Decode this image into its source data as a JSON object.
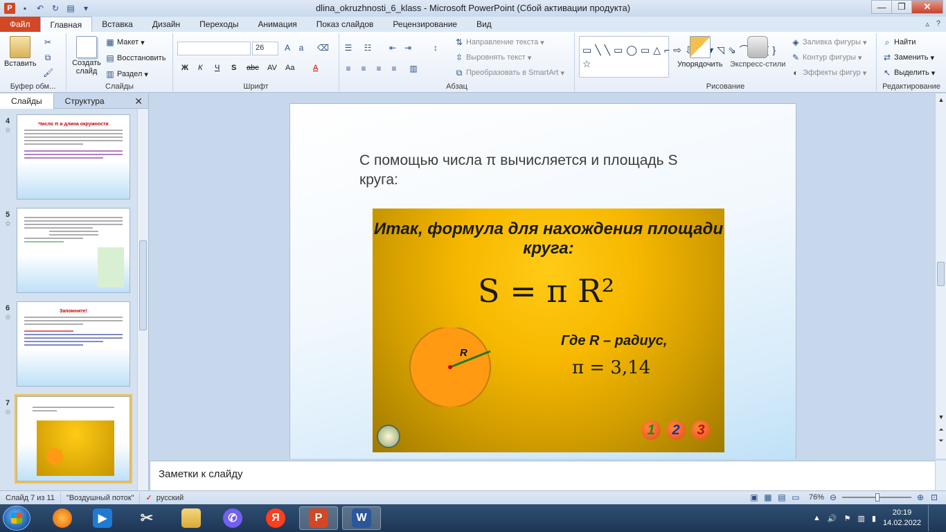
{
  "window": {
    "title": "dlina_okruzhnosti_6_klass  -  Microsoft PowerPoint (Сбой активации продукта)",
    "controls": [
      "—",
      "❐",
      "✕"
    ]
  },
  "ribbon_tabs": [
    "Файл",
    "Главная",
    "Вставка",
    "Дизайн",
    "Переходы",
    "Анимация",
    "Показ слайдов",
    "Рецензирование",
    "Вид"
  ],
  "ribbon": {
    "clipboard": {
      "label": "Буфер обм...",
      "paste": "Вставить"
    },
    "slides": {
      "label": "Слайды",
      "new_slide": "Создать слайд",
      "layout": "Макет",
      "reset": "Восстановить",
      "section": "Раздел"
    },
    "font": {
      "label": "Шрифт",
      "font_name": "",
      "font_size": "26",
      "bold": "Ж",
      "italic": "К",
      "underline": "Ч",
      "shadow": "S",
      "strike": "abc",
      "spacing": "AV",
      "case": "Aa",
      "color": "A"
    },
    "paragraph": {
      "label": "Абзац",
      "text_direction": "Направление текста",
      "align_text": "Выровнять текст",
      "smartart": "Преобразовать в SmartArt"
    },
    "drawing": {
      "label": "Рисование",
      "arrange": "Упорядочить",
      "quick_styles": "Экспресс-стили",
      "shape_fill": "Заливка фигуры",
      "shape_outline": "Контур фигуры",
      "shape_effects": "Эффекты фигур"
    },
    "editing": {
      "label": "Редактирование",
      "find": "Найти",
      "replace": "Заменить",
      "select": "Выделить"
    }
  },
  "left_panel": {
    "tabs": [
      "Слайды",
      "Структура"
    ],
    "thumbnails": [
      {
        "number": "4",
        "title": "Число π и длина окружности",
        "selected": false
      },
      {
        "number": "5",
        "title": "",
        "selected": false
      },
      {
        "number": "6",
        "title": "Запомните!",
        "selected": false
      },
      {
        "number": "7",
        "title": "",
        "selected": true
      }
    ]
  },
  "slide": {
    "text": "С помощью числа π вычисляется и площадь S круга:",
    "image": {
      "title": "Итак, формула для нахождения площади круга:",
      "formula": "S = π R²",
      "radius_label": "R",
      "where": "Где R – радиус,",
      "pi_value": "π = 3,14",
      "numbers": [
        "1",
        "2",
        "3"
      ]
    }
  },
  "notes": {
    "placeholder": "Заметки к слайду"
  },
  "status": {
    "slide": "Слайд 7 из 11",
    "theme": "\"Воздушный поток\"",
    "language": "русский",
    "zoom": "76%"
  },
  "taskbar": {
    "time": "20:19",
    "date": "14.02.2022",
    "apps": [
      "firefox",
      "media",
      "paint",
      "explorer",
      "viber",
      "yandex",
      "powerpoint",
      "word"
    ]
  },
  "colors": {
    "accent": "#d24726",
    "ribbon": "#dde8f5",
    "formula_bg": "#f7b800"
  }
}
